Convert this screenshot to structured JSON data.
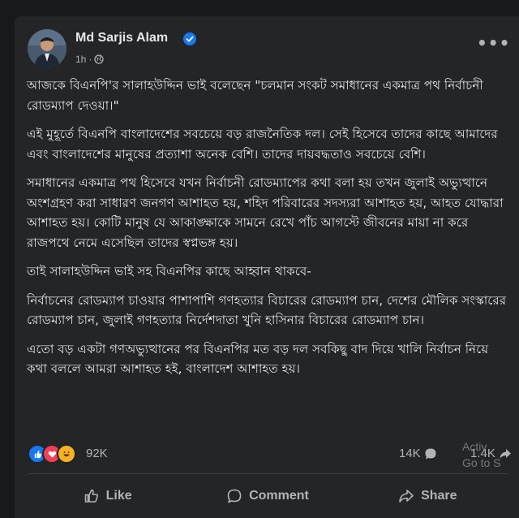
{
  "post": {
    "author": "Md Sarjis Alam",
    "time": "1h",
    "more_label": "•••",
    "paragraphs": [
      "আজকে বিএনপি'র সালাহউদ্দিন ভাই বলেছেন \"চলমান সংকট সমাধানের একমাত্র পথ নির্বাচনী রোডম্যাপ দেওয়া।\"",
      "এই মুহূর্তে বিএনপি বাংলাদেশের সবচেয়ে বড় রাজনৈতিক দল। সেই হিসেবে তাদের কাছে আমাদের এবং বাংলাদেশের মানুষের প্রত্যাশা অনেক বেশি। তাদের দায়বদ্ধতাও সবচেয়ে বেশি।",
      "সমাধানের একমাত্র পথ হিসেবে যখন নির্বাচনী রোডম্যাপের কথা বলা হয় তখন জুলাই অভ্যুত্থানে অংশগ্রহণ করা সাধারণ জনগণ আশাহত হয়, শহিদ পরিবারের সদস্যরা আশাহত হয়, আহত যোদ্ধারা আশাহত হয়। কোটি মানুষ যে আকাঙ্ক্ষাকে সামনে রেখে পাঁচ আগস্টে জীবনের মায়া না করে রাজপথে নেমে এসেছিল তাদের স্বপ্নভঙ্গ হয়।",
      "তাই সালাহউদ্দিন ভাই সহ বিএনপির কাছে আহ্বান থাকবে-",
      "নির্বাচনের রোডম্যাপ চাওয়ার পাশাপাশি গণহত্যার বিচারের রোডম্যাপ চান, দেশের মৌলিক সংস্কারের রোডম্যাপ চান, জুলাই গণহত্যার নির্দেশদাতা খুনি হাসিনার বিচারের রোডম্যাপ চান।",
      "এতো বড় একটা গণঅভ্যুত্থানের পর বিএনপির মত বড় দল সবকিছু বাদ দিয়ে খালি নির্বাচন নিয়ে কথা বললে আমরা আশাহত হই, বাংলাদেশ আশাহত হয়।"
    ]
  },
  "stats": {
    "reactions": "92K",
    "comments": "14K",
    "shares": "1.4K"
  },
  "actions": {
    "like": "Like",
    "comment": "Comment",
    "share": "Share"
  },
  "watermark": {
    "line1": "Activ",
    "line2": "Go to S"
  },
  "colors": {
    "background": "#18191a",
    "card": "#242526",
    "text": "#e4e6eb",
    "muted": "#b0b3b8",
    "verified": "#1877f2"
  }
}
